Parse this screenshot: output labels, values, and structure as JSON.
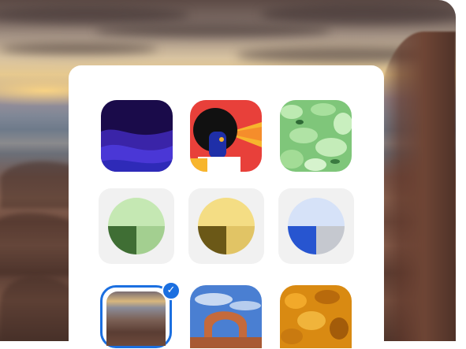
{
  "desktop": {
    "background_icon": "canyon-landscape-wallpaper"
  },
  "wallpaper_picker": {
    "image_tiles": [
      {
        "name": "blue-dunes-wallpaper",
        "accent": "#2b1a7a"
      },
      {
        "name": "portrait-art-wallpaper",
        "accent": "#e8403a"
      },
      {
        "name": "green-foliage-wallpaper",
        "accent": "#8fd38a"
      }
    ],
    "color_tiles": [
      {
        "name": "green-theme",
        "light": "#c5e8b3",
        "dark": "#3f6e34",
        "mid": "#a3cf90"
      },
      {
        "name": "yellow-theme",
        "light": "#f4dd84",
        "dark": "#6b5817",
        "mid": "#e1c465"
      },
      {
        "name": "blue-theme",
        "light": "#d6e2f8",
        "dark": "#2755d0",
        "mid": "#c5c8cf"
      }
    ],
    "bottom_tiles": [
      {
        "name": "canyon-wallpaper",
        "selected": true
      },
      {
        "name": "arch-wallpaper",
        "selected": false
      },
      {
        "name": "autumn-leaves-wallpaper",
        "selected": false
      }
    ],
    "selected_check": "✓",
    "selection_color": "#1b6fe0"
  }
}
